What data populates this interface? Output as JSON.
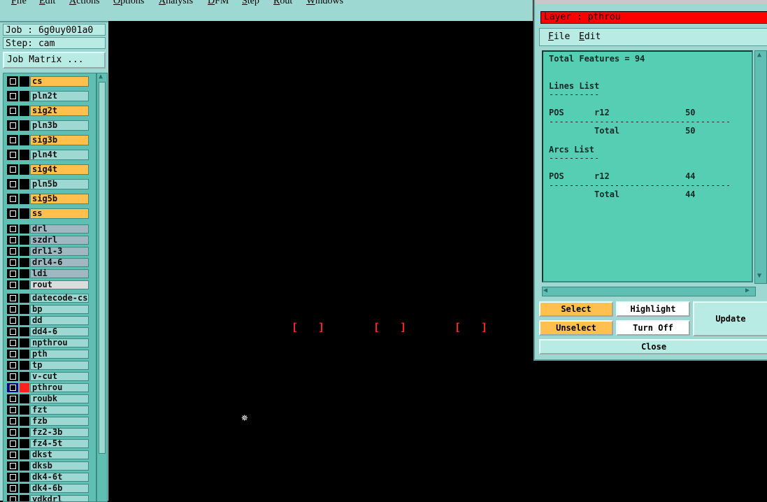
{
  "menubar": [
    "File",
    "Edit",
    "Actions",
    "Options",
    "Analysis",
    "DFM",
    "Step",
    "Rout",
    "Windows"
  ],
  "job": {
    "label": "Job : 6g0uy001a0",
    "step": "Step: cam",
    "matrix_button": "Job Matrix ..."
  },
  "layers": [
    {
      "name": "cs",
      "color": "#ffc04d",
      "size": "big"
    },
    {
      "name": "pln2t",
      "color": "#9dd9d2",
      "size": "big"
    },
    {
      "name": "sig2t",
      "color": "#ffc04d",
      "size": "big"
    },
    {
      "name": "pln3b",
      "color": "#9dd9d2",
      "size": "big"
    },
    {
      "name": "sig3b",
      "color": "#ffc04d",
      "size": "big"
    },
    {
      "name": "pln4t",
      "color": "#9dd9d2",
      "size": "big"
    },
    {
      "name": "sig4t",
      "color": "#ffc04d",
      "size": "big"
    },
    {
      "name": "pln5b",
      "color": "#9dd9d2",
      "size": "big"
    },
    {
      "name": "sig5b",
      "color": "#ffc04d",
      "size": "big"
    },
    {
      "name": "ss",
      "color": "#ffc04d",
      "size": "big"
    },
    {
      "name": "drl",
      "color": "#9fb8c2",
      "size": "sm"
    },
    {
      "name": "szdrl",
      "color": "#9fb8c2",
      "size": "sm"
    },
    {
      "name": "drl1-3",
      "color": "#9fb8c2",
      "size": "sm"
    },
    {
      "name": "drl4-6",
      "color": "#9fb8c2",
      "size": "sm"
    },
    {
      "name": "ldi",
      "color": "#9fb8c2",
      "size": "sm"
    },
    {
      "name": "rout",
      "color": "#dcdcdc",
      "size": "sm"
    },
    {
      "name": "datecode-cs",
      "color": "#9dd9d2",
      "size": "sm"
    },
    {
      "name": "bp",
      "color": "#9dd9d2",
      "size": "sm"
    },
    {
      "name": "dd",
      "color": "#9dd9d2",
      "size": "sm"
    },
    {
      "name": "dd4-6",
      "color": "#9dd9d2",
      "size": "sm"
    },
    {
      "name": "npthrou",
      "color": "#9dd9d2",
      "size": "sm"
    },
    {
      "name": "pth",
      "color": "#9dd9d2",
      "size": "sm"
    },
    {
      "name": "tp",
      "color": "#9dd9d2",
      "size": "sm"
    },
    {
      "name": "v-cut",
      "color": "#9dd9d2",
      "size": "sm"
    },
    {
      "name": "pthrou",
      "color": "#9dd9d2",
      "size": "sm",
      "active": true
    },
    {
      "name": "roubk",
      "color": "#9dd9d2",
      "size": "sm"
    },
    {
      "name": "fzt",
      "color": "#9dd9d2",
      "size": "sm"
    },
    {
      "name": "fzb",
      "color": "#9dd9d2",
      "size": "sm"
    },
    {
      "name": "fz2-3b",
      "color": "#9dd9d2",
      "size": "sm"
    },
    {
      "name": "fz4-5t",
      "color": "#9dd9d2",
      "size": "sm"
    },
    {
      "name": "dkst",
      "color": "#9dd9d2",
      "size": "sm"
    },
    {
      "name": "dksb",
      "color": "#9dd9d2",
      "size": "sm"
    },
    {
      "name": "dk4-6t",
      "color": "#9dd9d2",
      "size": "sm"
    },
    {
      "name": "dk4-6b",
      "color": "#9dd9d2",
      "size": "sm"
    },
    {
      "name": "ydkdrl",
      "color": "#9dd9d2",
      "size": "sm"
    }
  ],
  "canvas": {
    "feature_glyph": "[ ]",
    "cursor_glyph": "✵"
  },
  "popup": {
    "layer_label": "Layer :  pthrou",
    "menu": [
      "File",
      "Edit"
    ],
    "report": {
      "total": "Total Features = 94",
      "lines_heading": "Lines List",
      "lines_row": "POS      r12               50",
      "lines_total": "         Total             50",
      "arcs_heading": "Arcs List",
      "arcs_row": "POS      r12               44",
      "arcs_total": "         Total             44",
      "short_rule": "----------",
      "long_rule": "------------------------------------"
    },
    "buttons": {
      "select": "Select",
      "unselect": "Unselect",
      "highlight": "Highlight",
      "turnoff": "Turn Off",
      "update": "Update",
      "close": "Close"
    }
  }
}
